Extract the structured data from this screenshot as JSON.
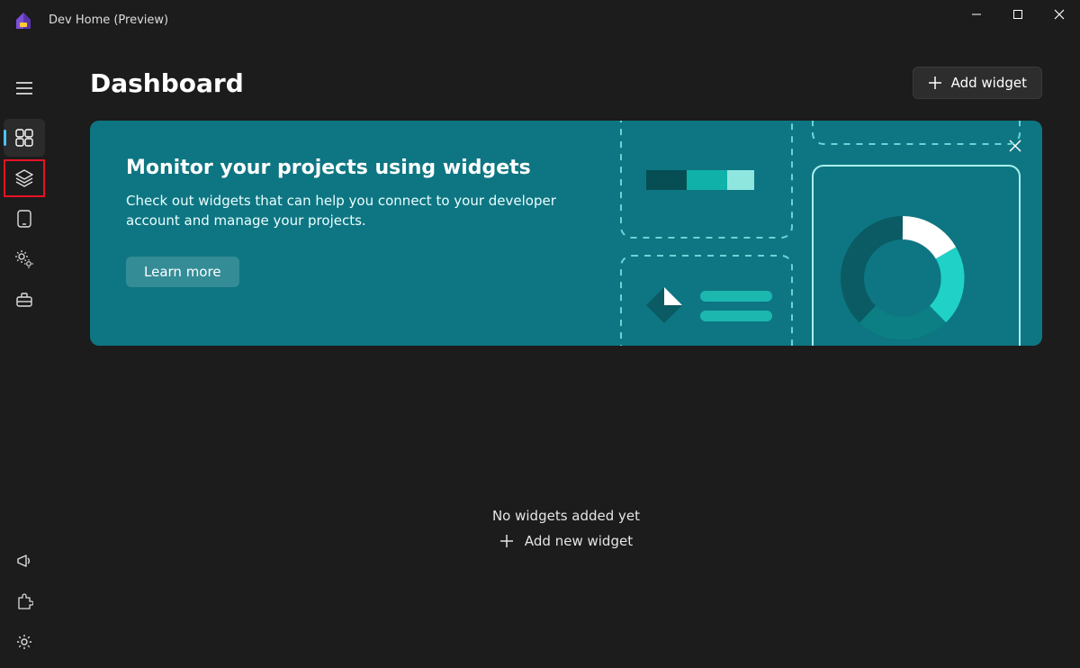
{
  "app": {
    "title": "Dev Home (Preview)"
  },
  "page": {
    "title": "Dashboard",
    "add_widget_label": "Add widget"
  },
  "banner": {
    "title": "Monitor your projects using widgets",
    "description": "Check out widgets that can help you connect to your developer account and manage your projects.",
    "learn_more_label": "Learn more"
  },
  "empty_state": {
    "title": "No widgets added yet",
    "action_label": "Add new widget"
  },
  "sidebar": {
    "items": [
      {
        "id": "dashboard",
        "icon": "dashboard-icon",
        "active": true
      },
      {
        "id": "machine-config",
        "icon": "layers-icon",
        "active": false,
        "highlight": true
      },
      {
        "id": "environments",
        "icon": "device-icon",
        "active": false
      },
      {
        "id": "config",
        "icon": "gears-icon",
        "active": false
      },
      {
        "id": "utilities",
        "icon": "toolbox-icon",
        "active": false
      }
    ],
    "footer": [
      {
        "id": "feedback",
        "icon": "megaphone-icon"
      },
      {
        "id": "extensions",
        "icon": "puzzle-icon"
      },
      {
        "id": "settings",
        "icon": "gear-icon"
      }
    ]
  }
}
